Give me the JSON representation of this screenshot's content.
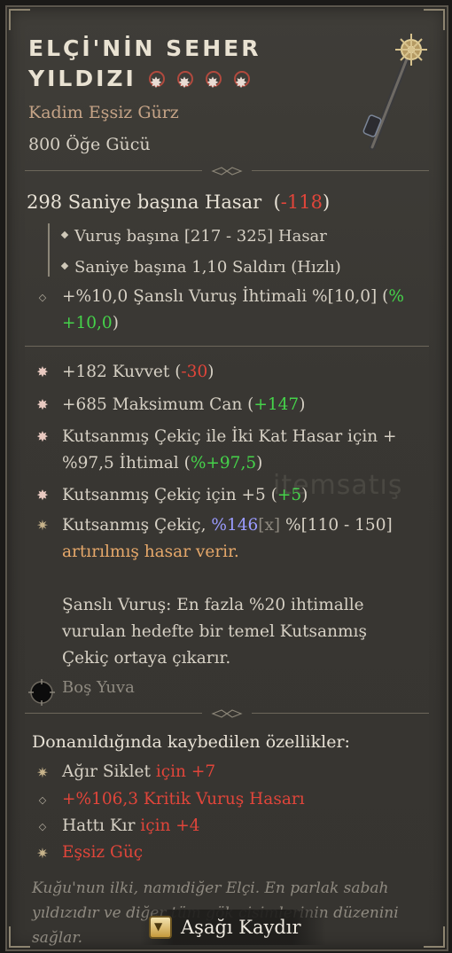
{
  "item": {
    "name_line1": "ELÇİ'NİN SEHER",
    "name_line2": "YILDIZI",
    "rarity_icons": [
      "star-icon",
      "star-icon",
      "star-icon",
      "star-icon"
    ],
    "type": "Kadim Eşsiz Gürz",
    "power": "800 Öğe Gücü"
  },
  "dps": {
    "label": "298 Saniye başına Hasar",
    "open": "(",
    "delta": "-118",
    "close": ")",
    "lines": [
      "Vuruş başına [217 - 325] Hasar",
      "Saniye başına 1,10 Saldırı (Hızlı)"
    ]
  },
  "implicit": {
    "text": "+%10,0 Şanslı Vuruş İhtimali %[10,0]",
    "open": "(",
    "delta_l1": "%",
    "delta_l2": "+10,0",
    "close": ")"
  },
  "affixes": [
    {
      "text": "+182 Kuvvet",
      "open": "(",
      "delta": "-30",
      "close": ")"
    },
    {
      "text": "+685 Maksimum Can",
      "open": "(",
      "delta": "+147",
      "close": ")"
    },
    {
      "text_l1": "Kutsanmış Çekiç ile İki Kat Hasar için +",
      "text_l2": "%97,5 İhtimal",
      "open": "(",
      "delta": "%+97,5",
      "close": ")"
    },
    {
      "text": "Kutsanmış Çekiç için +5",
      "open": "(",
      "delta": "+5",
      "close": ")"
    }
  ],
  "legendary": {
    "pre": "Kutsanmış Çekiç, ",
    "value": "%146",
    "mark": "[x]",
    "range": " %[110 - 150]",
    "line2": "artırılmış hasar verir."
  },
  "unique_power": [
    "Şanslı Vuruş: En fazla %20 ihtimalle",
    "vurulan hedefte bir temel Kutsanmış",
    "Çekiç ortaya çıkarır."
  ],
  "socket": {
    "label": "Boş Yuva"
  },
  "lost": {
    "title": "Donanıldığında kaybedilen özellikler:",
    "items": [
      {
        "white": "Ağır Siklet ",
        "red": "için +7"
      },
      {
        "white": "",
        "red": "+%106,3 Kritik Vuruş Hasarı"
      },
      {
        "white": "Hattı Kır ",
        "red": "için +4"
      },
      {
        "white": "",
        "red": "Eşsiz Güç"
      }
    ]
  },
  "flavor": [
    "Kuğu'nun ilki, namıdiğer Elçi. En parlak sabah",
    "yıldızıdır ve diğer tüm gök cisimlerinin düzenini",
    "sağlar."
  ],
  "scroll": {
    "label": "Aşağı Kaydır",
    "icon": "down-arrow-key-icon"
  },
  "watermark": "itemsatış",
  "colors": {
    "negative": "#e0453a",
    "positive": "#45d34a",
    "unique_text": "#e6a86a",
    "item_type": "#c6a487"
  }
}
